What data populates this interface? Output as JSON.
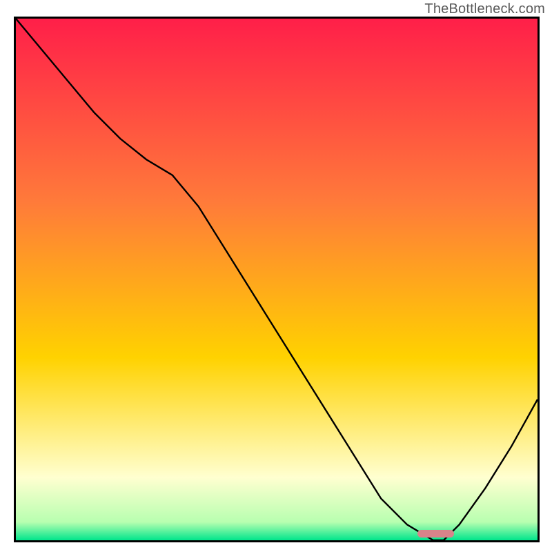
{
  "watermark": "TheBottleneck.com",
  "colors": {
    "top": "#ff1f49",
    "mid1": "#ff7a3a",
    "mid2": "#ffd200",
    "pale": "#ffffd0",
    "green": "#00e58c",
    "marker": "#d9838a",
    "border": "#000000",
    "curve": "#000000"
  },
  "chart_data": {
    "type": "line",
    "title": "",
    "xlabel": "",
    "ylabel": "",
    "xlim": [
      0,
      100
    ],
    "ylim": [
      0,
      100
    ],
    "x": [
      0,
      5,
      10,
      15,
      20,
      25,
      30,
      35,
      40,
      45,
      50,
      55,
      60,
      65,
      70,
      75,
      80,
      82,
      85,
      90,
      95,
      100
    ],
    "y": [
      100,
      94,
      88,
      82,
      77,
      73,
      70,
      64,
      56,
      48,
      40,
      32,
      24,
      16,
      8,
      3,
      0,
      0,
      3,
      10,
      18,
      27
    ],
    "optimum_range_x": [
      77,
      84
    ],
    "gradient_stops": [
      {
        "offset": 0.0,
        "color": "#ff1f49"
      },
      {
        "offset": 0.35,
        "color": "#ff7a3a"
      },
      {
        "offset": 0.65,
        "color": "#ffd200"
      },
      {
        "offset": 0.88,
        "color": "#ffffd0"
      },
      {
        "offset": 0.965,
        "color": "#b8ffb0"
      },
      {
        "offset": 1.0,
        "color": "#00e58c"
      }
    ]
  }
}
